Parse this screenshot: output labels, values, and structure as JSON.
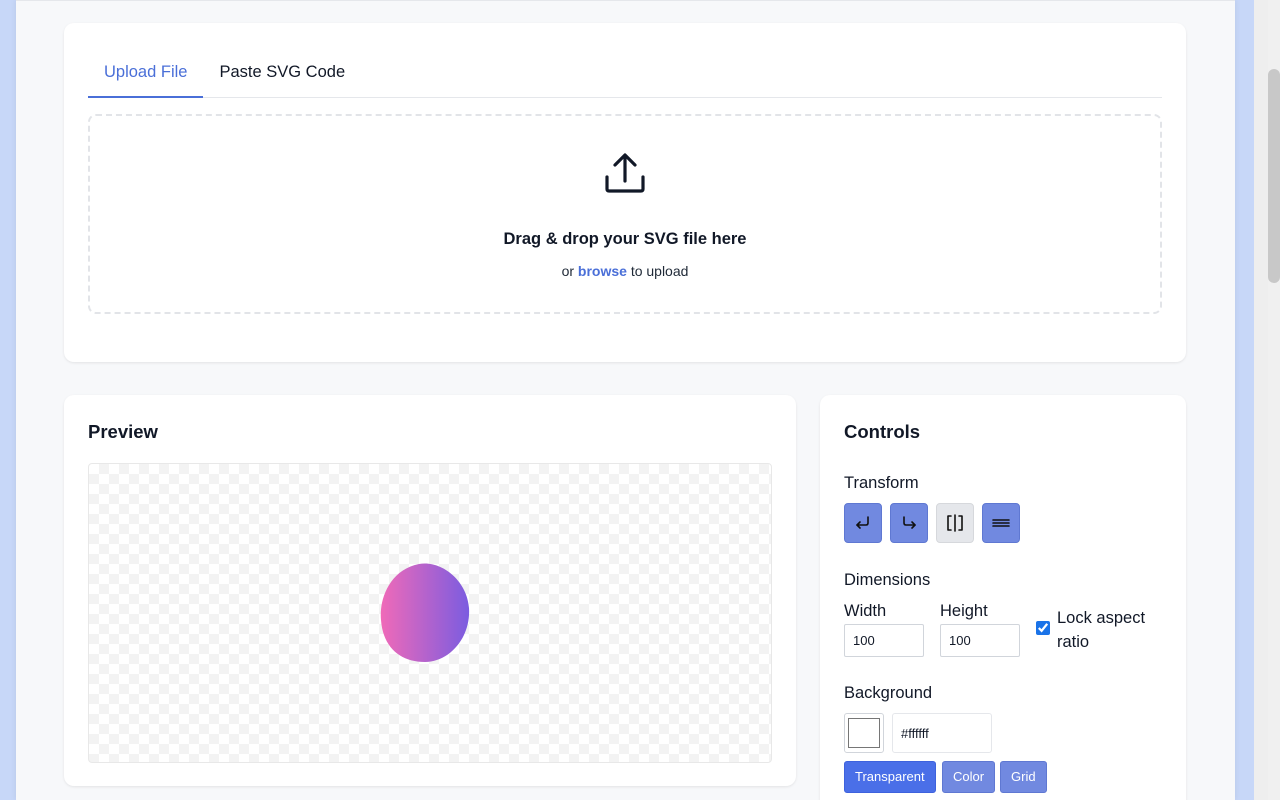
{
  "tabs": [
    {
      "label": "Upload File",
      "active": true
    },
    {
      "label": "Paste SVG Code",
      "active": false
    }
  ],
  "dropzone": {
    "icon": "upload-icon",
    "title": "Drag & drop your SVG file here",
    "sub_prefix": "or",
    "sub_link": "browse",
    "sub_suffix": "to upload"
  },
  "preview": {
    "title": "Preview",
    "shape_gradient": [
      "#f06ab8",
      "#7b5ce0"
    ]
  },
  "controls": {
    "title": "Controls",
    "transform": {
      "label": "Transform",
      "buttons": [
        {
          "icon": "rotate-left-icon"
        },
        {
          "icon": "rotate-right-icon"
        },
        {
          "icon": "flip-horizontal-icon"
        },
        {
          "icon": "flip-vertical-icon"
        }
      ]
    },
    "dimensions": {
      "label": "Dimensions",
      "width_label": "Width",
      "width_value": "100",
      "height_label": "Height",
      "height_value": "100",
      "lock_label": "Lock aspect ratio",
      "lock_checked": true
    },
    "background": {
      "label": "Background",
      "color_value": "#ffffff",
      "buttons": [
        {
          "label": "Transparent",
          "active": true
        },
        {
          "label": "Color",
          "active": false
        },
        {
          "label": "Grid",
          "active": false
        }
      ]
    }
  },
  "colors": {
    "accent": "#4a6fd8",
    "button": "#7189e0",
    "button_active": "#4a6fe8",
    "page_bg": "#f7f8fa",
    "outer_bg": "#c7d7f8"
  }
}
